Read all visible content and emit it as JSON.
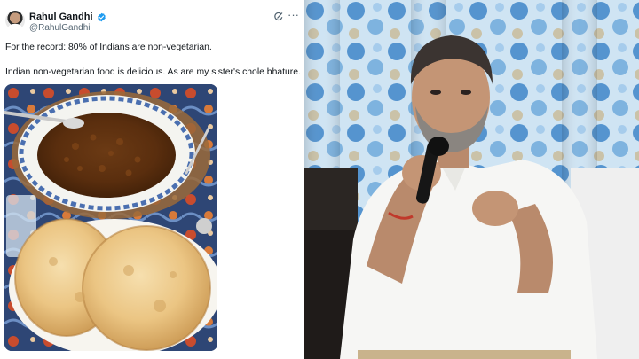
{
  "tweet": {
    "display_name": "Rahul Gandhi",
    "handle": "@RahulGandhi",
    "verified_icon": "verified-badge-icon",
    "grok_icon": "grok-icon",
    "more_icon": "more-options-icon",
    "text_line_1": "For the record: 80% of Indians are non-vegetarian.",
    "text_line_2": "Indian non-vegetarian food is delicious. As are my sister's chole bhature.",
    "photo_subject": "chole-bhature-plate"
  },
  "colors": {
    "verified_blue": "#1d9bf0",
    "text_primary": "#0f1419",
    "text_secondary": "#536471",
    "curtain_blue": "#3f86c9"
  }
}
